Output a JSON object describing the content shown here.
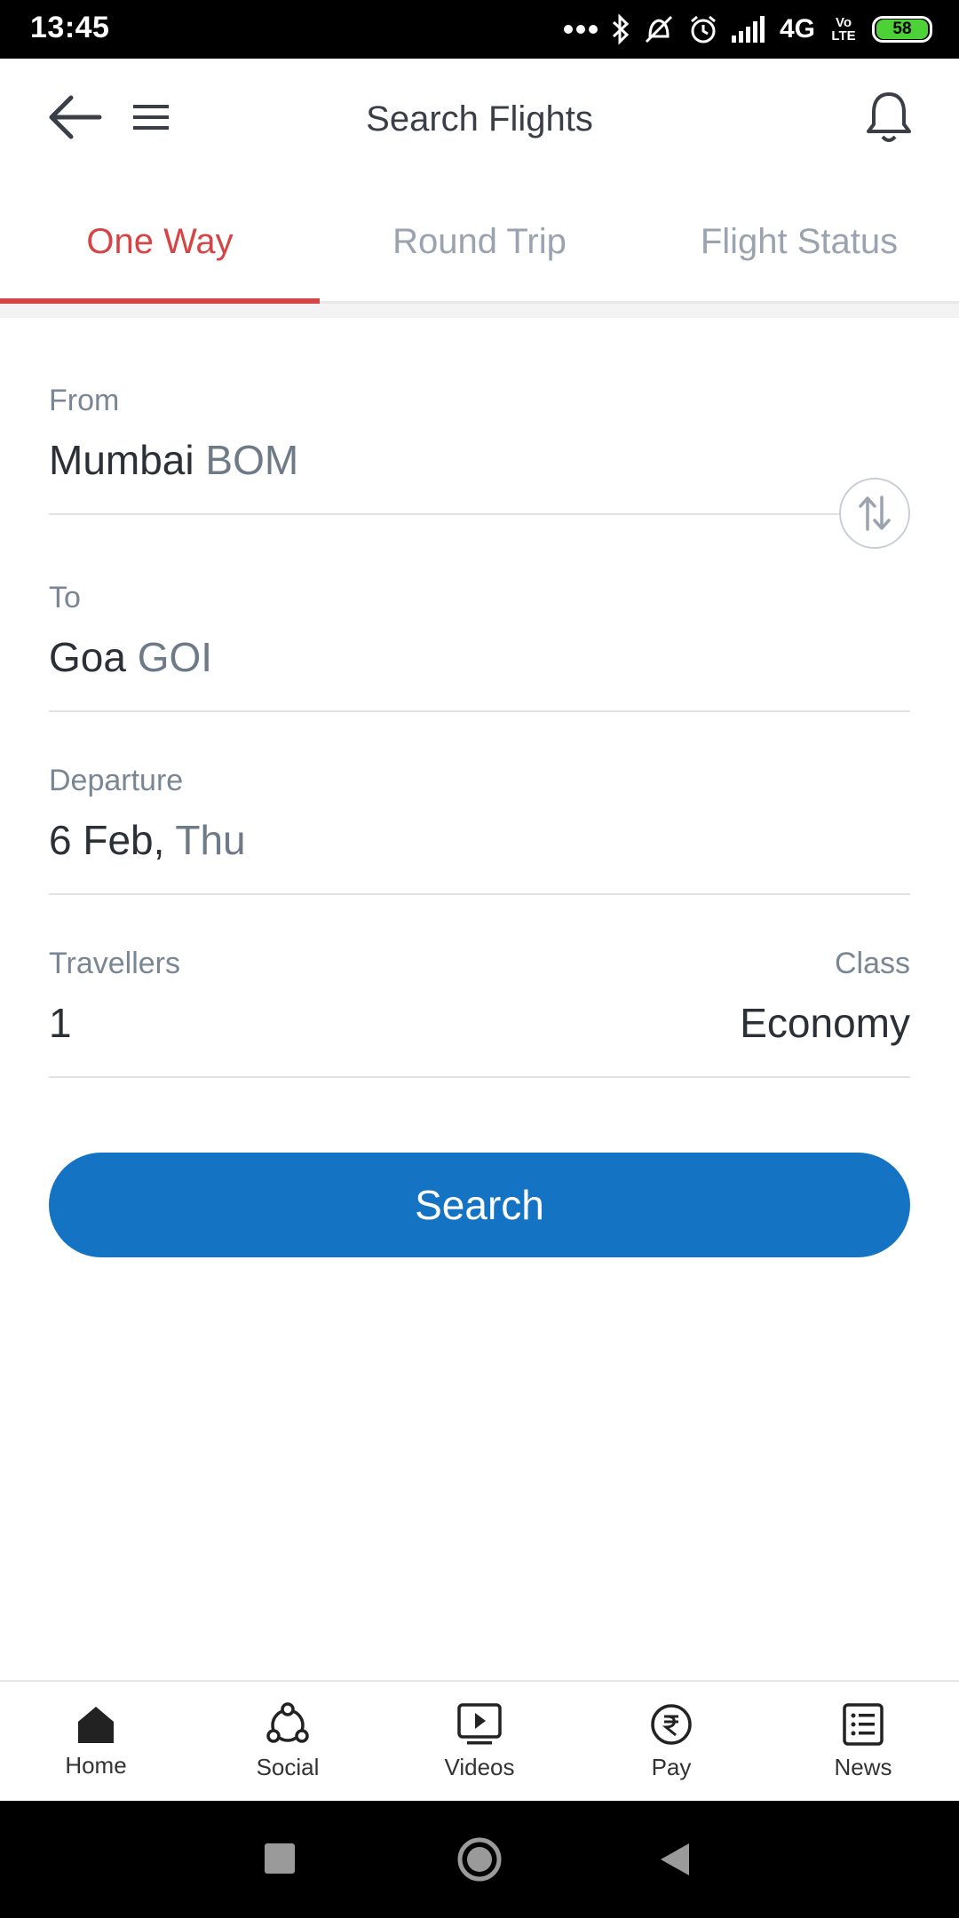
{
  "status_bar": {
    "time": "13:45",
    "network": "4G",
    "volte": "Vo LTE",
    "battery": "58"
  },
  "header": {
    "title": "Search Flights"
  },
  "tabs": [
    {
      "label": "One Way",
      "active": true
    },
    {
      "label": "Round Trip",
      "active": false
    },
    {
      "label": "Flight Status",
      "active": false
    }
  ],
  "form": {
    "from": {
      "label": "From",
      "city": "Mumbai",
      "code": "BOM"
    },
    "to": {
      "label": "To",
      "city": "Goa",
      "code": "GOI"
    },
    "departure": {
      "label": "Departure",
      "date": "6 Feb,",
      "day": "Thu"
    },
    "travellers": {
      "label": "Travellers",
      "value": "1"
    },
    "class": {
      "label": "Class",
      "value": "Economy"
    },
    "search_label": "Search"
  },
  "bottom_nav": [
    {
      "label": "Home",
      "icon": "home-icon"
    },
    {
      "label": "Social",
      "icon": "social-icon"
    },
    {
      "label": "Videos",
      "icon": "videos-icon"
    },
    {
      "label": "Pay",
      "icon": "pay-icon"
    },
    {
      "label": "News",
      "icon": "news-icon"
    }
  ],
  "colors": {
    "accent_tab": "#d64545",
    "primary_button": "#1473c2",
    "muted_text": "#7a8694"
  }
}
